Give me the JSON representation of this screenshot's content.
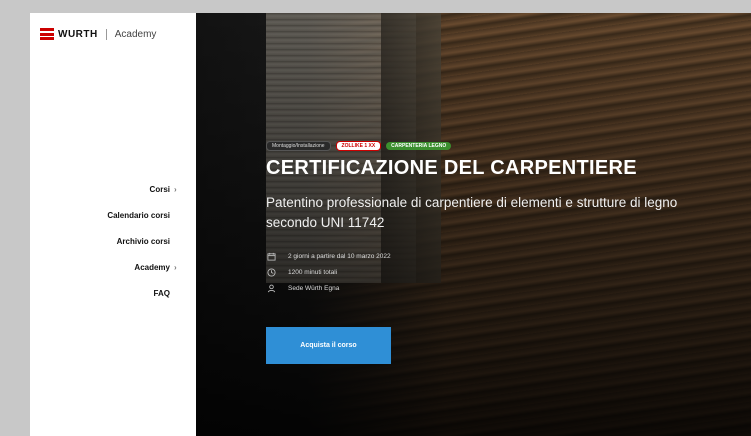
{
  "brand": {
    "name": "WURTH",
    "sub": "Academy"
  },
  "nav": {
    "items": [
      {
        "label": "Corsi",
        "has_submenu": true
      },
      {
        "label": "Calendario corsi",
        "has_submenu": false
      },
      {
        "label": "Archivio corsi",
        "has_submenu": false
      },
      {
        "label": "Academy",
        "has_submenu": true
      },
      {
        "label": "FAQ",
        "has_submenu": false
      }
    ],
    "chevron": "›"
  },
  "hero": {
    "category": "Montaggio/Installazione",
    "tag_red": "ZOLLIKE 1 XX",
    "tag_green": "CARPENTERIA LEGNO",
    "title": "CERTIFICAZIONE DEL CARPENTIERE",
    "subtitle": "Patentino professionale di carpentiere di elementi e strutture di legno secondo UNI 11742",
    "meta": {
      "dates": "2 giorni a partire dal 10 marzo 2022",
      "duration": "1200 minuti totali",
      "location": "Sede Würth Egna"
    },
    "cta_label": "Acquista il corso"
  },
  "colors": {
    "brand_red": "#cc0000",
    "cta_blue": "#2f8fd6",
    "tag_green": "#3b8f2e"
  },
  "icons": {
    "calendar": "calendar-icon",
    "clock": "clock-icon",
    "location": "person-location-icon"
  }
}
